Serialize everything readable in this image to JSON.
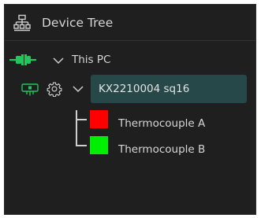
{
  "header": {
    "title": "Device Tree",
    "icon": "tree-structure-icon"
  },
  "tree": {
    "root": {
      "label": "This PC",
      "status_icon": "plug-connected-icon",
      "status_color": "#22c55e",
      "expanded": true
    },
    "device": {
      "name": "KX2210004 sq16",
      "status_icon": "plug-icon",
      "status_color": "#22c55e",
      "settings_icon": "gear-icon",
      "expanded": true,
      "selected": true,
      "selected_color": "#264848"
    },
    "channels": [
      {
        "label": "Thermocouple A",
        "color": "#ff0000"
      },
      {
        "label": "Thermocouple B",
        "color": "#00ee00"
      }
    ]
  },
  "colors": {
    "background": "#1f1f1f",
    "text": "#d6d6d6"
  }
}
